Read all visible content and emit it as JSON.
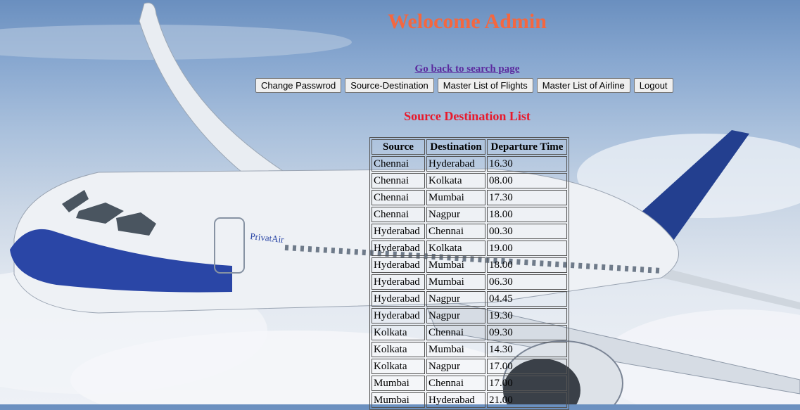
{
  "header": {
    "title": "Welocome Admin"
  },
  "nav": {
    "back_link": "Go back to search page",
    "buttons": [
      "Change Passwrod",
      "Source-Destination",
      "Master List of Flights",
      "Master List of Airline",
      "Logout"
    ]
  },
  "list": {
    "title": "Source Destination List",
    "columns": [
      "Source",
      "Destination",
      "Departure Time"
    ],
    "rows": [
      [
        "Chennai",
        "Hyderabad",
        "16.30"
      ],
      [
        "Chennai",
        "Kolkata",
        "08.00"
      ],
      [
        "Chennai",
        "Mumbai",
        "17.30"
      ],
      [
        "Chennai",
        "Nagpur",
        "18.00"
      ],
      [
        "Hyderabad",
        "Chennai",
        "00.30"
      ],
      [
        "Hyderabad",
        "Kolkata",
        "19.00"
      ],
      [
        "Hyderabad",
        "Mumbai",
        "18.00"
      ],
      [
        "Hyderabad",
        "Mumbai",
        "06.30"
      ],
      [
        "Hyderabad",
        "Nagpur",
        "04.45"
      ],
      [
        "Hyderabad",
        "Nagpur",
        "19.30"
      ],
      [
        "Kolkata",
        "Chennai",
        "09.30"
      ],
      [
        "Kolkata",
        "Mumbai",
        "14.30"
      ],
      [
        "Kolkata",
        "Nagpur",
        "17.00"
      ],
      [
        "Mumbai",
        "Chennai",
        "17.00"
      ],
      [
        "Mumbai",
        "Hyderabad",
        "21.00"
      ]
    ]
  },
  "background": {
    "aircraft_logo": "PrivatAir"
  }
}
